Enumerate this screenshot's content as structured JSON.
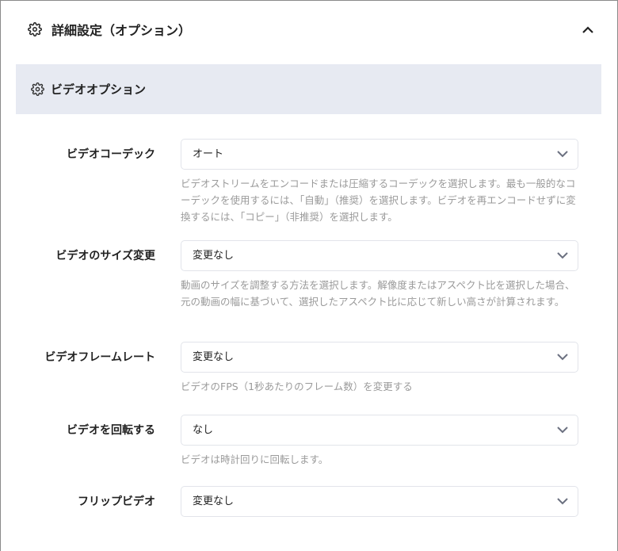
{
  "header": {
    "title": "詳細設定（オプション）"
  },
  "section": {
    "title": "ビデオオプション"
  },
  "fields": [
    {
      "label": "ビデオコーデック",
      "value": "オート",
      "help": "ビデオストリームをエンコードまたは圧縮するコーデックを選択します。最も一般的なコーデックを使用するには、「自動」（推奨）を選択します。ビデオを再エンコードせずに変換するには、「コピー」（非推奨）を選択します。"
    },
    {
      "label": "ビデオのサイズ変更",
      "value": "変更なし",
      "help": "動画のサイズを調整する方法を選択します。解像度またはアスペクト比を選択した場合、元の動画の幅に基づいて、選択したアスペクト比に応じて新しい高さが計算されます。"
    },
    {
      "label": "ビデオフレームレート",
      "value": "変更なし",
      "help": "ビデオのFPS（1秒あたりのフレーム数）を変更する"
    },
    {
      "label": "ビデオを回転する",
      "value": "なし",
      "help": "ビデオは時計回りに回転します。"
    },
    {
      "label": "フリップビデオ",
      "value": "変更なし"
    }
  ]
}
